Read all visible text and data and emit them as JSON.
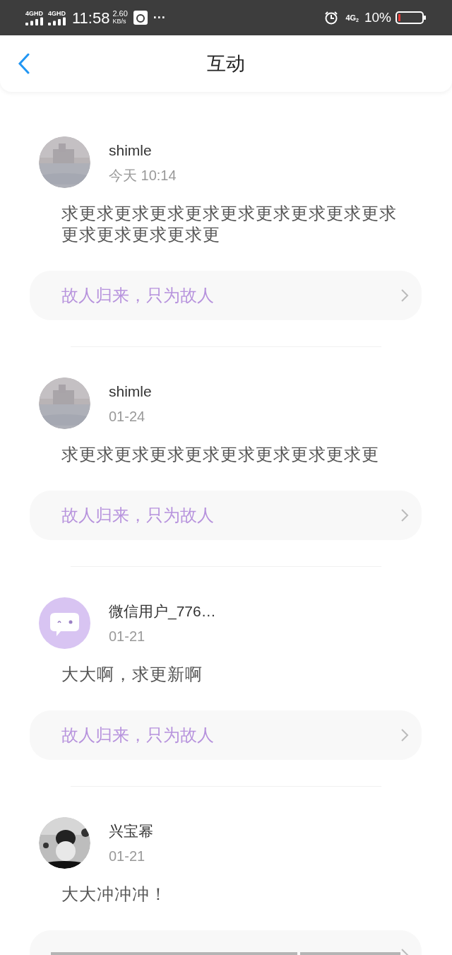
{
  "status_bar": {
    "networks": [
      "4GHD",
      "4GHD"
    ],
    "time": "11:58",
    "speed": "2.60",
    "speed_unit": "KB/s",
    "more": "···",
    "network_2": "4G",
    "network_2_sub": "2",
    "battery": "10%"
  },
  "header": {
    "title": "互动"
  },
  "items": [
    {
      "name": "shimle",
      "time": "今天 10:14",
      "comment": "求更求更求更求更求更求更求更求更求更求更求更求更求更求更",
      "link": "故人归来，只为故人"
    },
    {
      "name": "shimle",
      "time": "01-24",
      "comment": "求更求更求更求更求更求更求更求更求更",
      "link": "故人归来，只为故人"
    },
    {
      "avatar": {
        "kind": "default"
      },
      "name": "微信用户_776…",
      "time": "01-21",
      "comment": "大大啊，求更新啊",
      "link": "故人归来，只为故人"
    },
    {
      "avatar": {
        "kind": "dark-picture"
      },
      "name": "兴宝幂",
      "time": "01-21",
      "comment": "大大冲冲冲！"
    }
  ]
}
